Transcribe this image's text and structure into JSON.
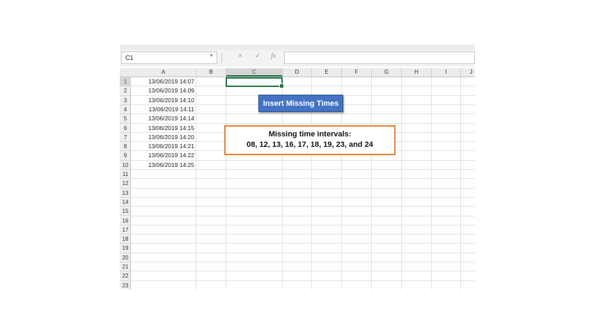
{
  "name_box": {
    "value": "C1"
  },
  "formula_bar": {
    "cancel_icon": "×",
    "enter_icon": "✓",
    "function_label": "fx",
    "value": ""
  },
  "columns": [
    "A",
    "B",
    "C",
    "D",
    "E",
    "F",
    "G",
    "H",
    "I",
    "J"
  ],
  "selected_column": "C",
  "rows": [
    "1",
    "2",
    "3",
    "4",
    "5",
    "6",
    "7",
    "8",
    "9",
    "10",
    "11",
    "12",
    "13",
    "14",
    "15",
    "16",
    "17",
    "18",
    "19",
    "20",
    "21",
    "22",
    "23"
  ],
  "selected_row": "1",
  "column_a_values": [
    "13/06/2019 14:07",
    "13/06/2019 14:09",
    "13/06/2019 14:10",
    "13/06/2019 14:11",
    "13/06/2019 14:14",
    "13/06/2019 14:15",
    "13/06/2019 14:20",
    "13/06/2019 14:21",
    "13/06/2019 14:22",
    "13/06/2019 14:25"
  ],
  "button": {
    "label": "Insert Missing Times"
  },
  "note": {
    "line1": "Missing time intervals:",
    "line2": "08, 12, 13, 16, 17, 18, 19, 23, and 24"
  },
  "colors": {
    "accent_green": "#217346",
    "button_blue": "#4472c4",
    "note_border": "#ed7d31"
  }
}
